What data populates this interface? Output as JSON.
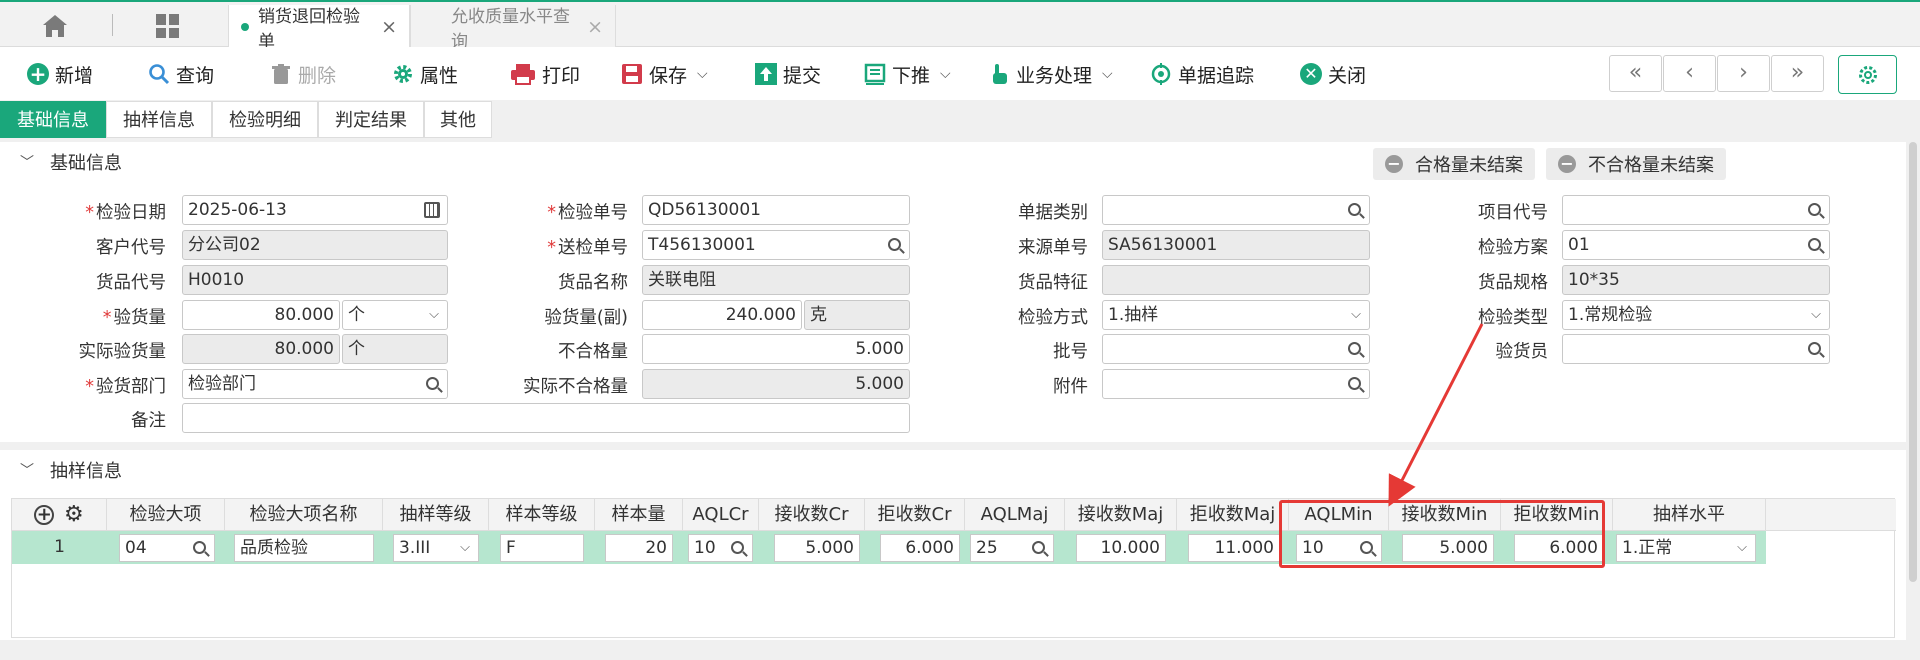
{
  "tabs": {
    "active": "销货退回检验单",
    "inactive": "允收质量水平查询",
    "close": "×"
  },
  "toolbar": {
    "new": "新增",
    "query": "查询",
    "delete": "删除",
    "properties": "属性",
    "print": "打印",
    "save": "保存",
    "submit": "提交",
    "push_down": "下推",
    "business": "业务处理",
    "trace": "单据追踪",
    "close": "关闭",
    "nav_first": "«",
    "nav_prev": "‹",
    "nav_next": "›",
    "nav_last": "»"
  },
  "section_tabs": [
    "基础信息",
    "抽样信息",
    "检验明细",
    "判定结果",
    "其他"
  ],
  "basic": {
    "title": "基础信息",
    "status_qualified": "合格量未结案",
    "status_unqualified": "不合格量未结案",
    "fields": {
      "inspect_date_label": "检验日期",
      "inspect_date": "2025-06-13",
      "customer_label": "客户代号",
      "customer": "分公司02",
      "product_code_label": "货品代号",
      "product_code": "H0010",
      "inspect_qty_label": "验货量",
      "inspect_qty": "80.000",
      "inspect_unit": "个",
      "actual_qty_label": "实际验货量",
      "actual_qty": "80.000",
      "actual_unit": "个",
      "dept_label": "验货部门",
      "dept": "检验部门",
      "remark_label": "备注",
      "remark": "",
      "inspect_no_label": "检验单号",
      "inspect_no": "QD56130001",
      "send_no_label": "送检单号",
      "send_no": "T456130001",
      "product_name_label": "货品名称",
      "product_name": "关联电阻",
      "inspect_qty2_label": "验货量(副)",
      "inspect_qty2": "240.000",
      "inspect_unit2": "克",
      "unqualified_label": "不合格量",
      "unqualified": "5.000",
      "actual_unqualified_label": "实际不合格量",
      "actual_unqualified": "5.000",
      "doc_type_label": "单据类别",
      "doc_type": "",
      "source_no_label": "来源单号",
      "source_no": "SA56130001",
      "product_feature_label": "货品特征",
      "product_feature": "",
      "method_label": "检验方式",
      "method": "1.抽样",
      "batch_label": "批号",
      "batch": "",
      "attachment_label": "附件",
      "attachment": "",
      "project_label": "项目代号",
      "project": "",
      "plan_label": "检验方案",
      "plan": "01",
      "spec_label": "货品规格",
      "spec": "10*35",
      "inspect_type_label": "检验类型",
      "inspect_type": "1.常规检验",
      "inspector_label": "验货员",
      "inspector": ""
    }
  },
  "sampling": {
    "title": "抽样信息",
    "columns": [
      "检验大项",
      "检验大项名称",
      "抽样等级",
      "样本等级",
      "样本量",
      "AQLCr",
      "接收数Cr",
      "拒收数Cr",
      "AQLMaj",
      "接收数Maj",
      "拒收数Maj",
      "AQLMin",
      "接收数Min",
      "拒收数Min",
      "抽样水平"
    ],
    "row": {
      "index": "1",
      "item": "04",
      "item_name": "品质检验",
      "level": "3.III",
      "sample_level": "F",
      "sample_size": "20",
      "aql_cr": "10",
      "accept_cr": "5.000",
      "reject_cr": "6.000",
      "aql_maj": "25",
      "accept_maj": "10.000",
      "reject_maj": "11.000",
      "aql_min": "10",
      "accept_min": "5.000",
      "reject_min": "6.000",
      "sampling_level": "1.正常"
    }
  },
  "colors": {
    "accent": "#1aa77b",
    "highlight": "#e53935",
    "row": "#b6e6cf"
  }
}
